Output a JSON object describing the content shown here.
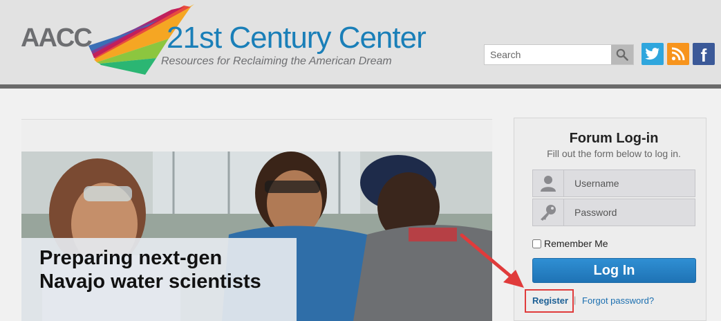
{
  "header": {
    "logo": {
      "abbr": "AACC",
      "title": "21st Century Center",
      "tagline": "Resources for Reclaiming the American Dream"
    },
    "search": {
      "placeholder": "Search"
    },
    "social": [
      {
        "name": "twitter-icon",
        "color": "#2fa6dd"
      },
      {
        "name": "rss-icon",
        "color": "#f7941d"
      },
      {
        "name": "facebook-icon",
        "color": "#3b5998",
        "glyph": "f"
      }
    ]
  },
  "feature": {
    "headline": "Preparing next-gen Navajo water scientists"
  },
  "login": {
    "title": "Forum Log-in",
    "subtitle": "Fill out the form below to log in.",
    "username_placeholder": "Username",
    "password_placeholder": "Password",
    "remember_label": "Remember Me",
    "submit_label": "Log In",
    "register_label": "Register",
    "separator": "|",
    "forgot_label": "Forgot password?",
    "accent_color": "#2f8fd3",
    "highlight_color": "#e03b3b"
  }
}
